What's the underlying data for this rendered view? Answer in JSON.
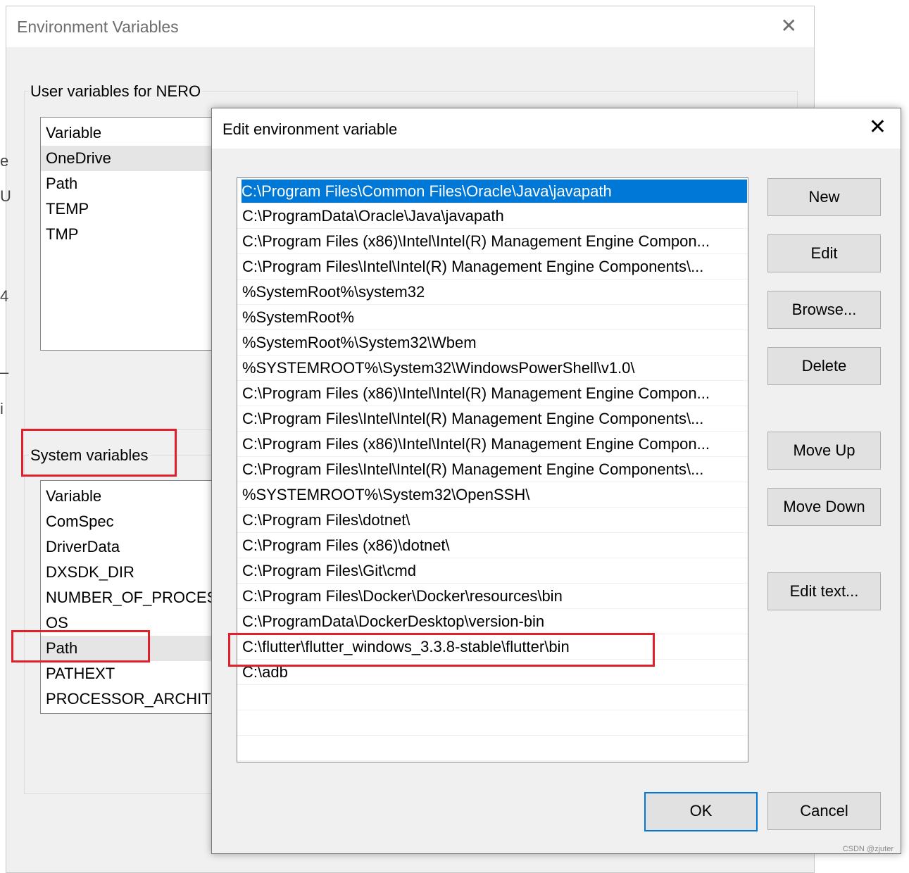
{
  "env_window": {
    "title": "Environment Variables",
    "close_glyph": "✕",
    "user_group": {
      "label": "User variables for NERO",
      "header": "Variable",
      "rows": [
        "OneDrive",
        "Path",
        "TEMP",
        "TMP"
      ]
    },
    "system_group": {
      "label": "System variables",
      "header": "Variable",
      "rows": [
        "ComSpec",
        "DriverData",
        "DXSDK_DIR",
        "NUMBER_OF_PROCESS",
        "OS",
        "Path",
        "PATHEXT",
        "PROCESSOR_ARCHITEC"
      ]
    },
    "edge_glyphs": [
      "e",
      "U",
      "4",
      "–",
      "i"
    ]
  },
  "edit_dialog": {
    "title": "Edit environment variable",
    "close_glyph": "✕",
    "paths": [
      "C:\\Program Files\\Common Files\\Oracle\\Java\\javapath",
      "C:\\ProgramData\\Oracle\\Java\\javapath",
      "C:\\Program Files (x86)\\Intel\\Intel(R) Management Engine Compon...",
      "C:\\Program Files\\Intel\\Intel(R) Management Engine Components\\...",
      "%SystemRoot%\\system32",
      "%SystemRoot%",
      "%SystemRoot%\\System32\\Wbem",
      "%SYSTEMROOT%\\System32\\WindowsPowerShell\\v1.0\\",
      "C:\\Program Files (x86)\\Intel\\Intel(R) Management Engine Compon...",
      "C:\\Program Files\\Intel\\Intel(R) Management Engine Components\\...",
      "C:\\Program Files (x86)\\Intel\\Intel(R) Management Engine Compon...",
      "C:\\Program Files\\Intel\\Intel(R) Management Engine Components\\...",
      "%SYSTEMROOT%\\System32\\OpenSSH\\",
      "C:\\Program Files\\dotnet\\",
      "C:\\Program Files (x86)\\dotnet\\",
      "C:\\Program Files\\Git\\cmd",
      "C:\\Program Files\\Docker\\Docker\\resources\\bin",
      "C:\\ProgramData\\DockerDesktop\\version-bin",
      "C:\\flutter\\flutter_windows_3.3.8-stable\\flutter\\bin",
      "C:\\adb",
      "",
      "",
      ""
    ],
    "buttons": {
      "new": "New",
      "edit": "Edit",
      "browse": "Browse...",
      "delete": "Delete",
      "move_up": "Move Up",
      "move_down": "Move Down",
      "edit_text": "Edit text...",
      "ok": "OK",
      "cancel": "Cancel"
    }
  },
  "watermark": "CSDN @zjuter",
  "colors": {
    "selection": "#0078d7",
    "highlight_box": "#e0202a"
  }
}
